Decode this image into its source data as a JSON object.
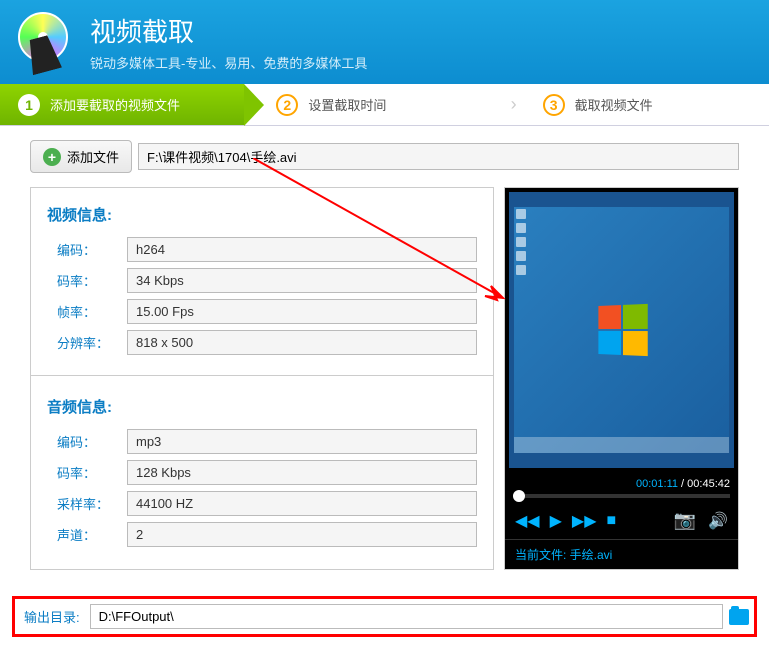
{
  "header": {
    "title": "视频截取",
    "subtitle": "锐动多媒体工具-专业、易用、免费的多媒体工具"
  },
  "steps": {
    "s1": {
      "num": "1",
      "label": "添加要截取的视频文件"
    },
    "s2": {
      "num": "2",
      "label": "设置截取时间"
    },
    "s3": {
      "num": "3",
      "label": "截取视频文件"
    }
  },
  "toolbar": {
    "add_label": "添加文件",
    "file_path": "F:\\课件视频\\1704\\手绘.avi"
  },
  "video_info": {
    "title": "视频信息:",
    "codec_label": "编码：",
    "codec_value": "h264",
    "bitrate_label": "码率：",
    "bitrate_value": "34 Kbps",
    "fps_label": "帧率：",
    "fps_value": "15.00 Fps",
    "res_label": "分辨率：",
    "res_value": "818 x 500"
  },
  "audio_info": {
    "title": "音频信息:",
    "codec_label": "编码：",
    "codec_value": "mp3",
    "bitrate_label": "码率：",
    "bitrate_value": "128 Kbps",
    "sample_label": "采样率：",
    "sample_value": "44100 HZ",
    "channel_label": "声道：",
    "channel_value": "2"
  },
  "preview": {
    "time_current": "00:01:11",
    "time_sep": " / ",
    "time_total": "00:45:42",
    "current_file_label": "当前文件: ",
    "current_file_name": "手绘.avi"
  },
  "output": {
    "label": "输出目录:",
    "path": "D:\\FFOutput\\"
  }
}
